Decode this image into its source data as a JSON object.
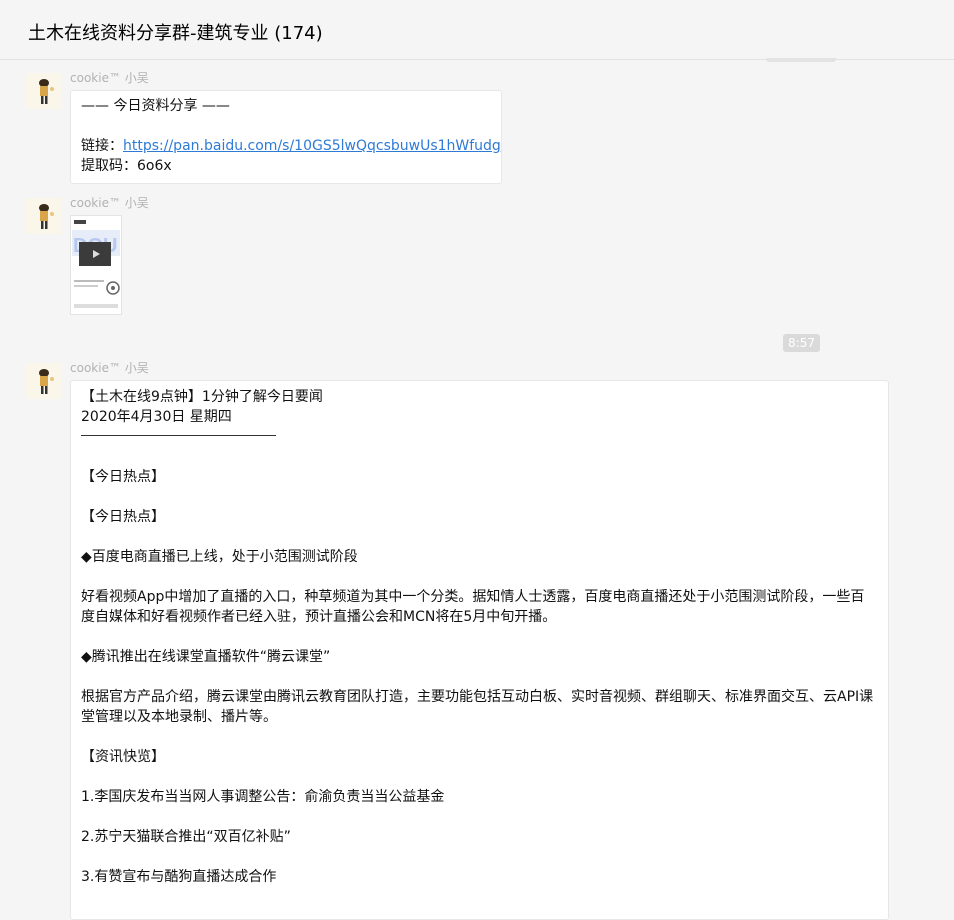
{
  "header": {
    "title": "土木在线资料分享群-建筑专业 (174)"
  },
  "messages": [
    {
      "sender": "cookie™ 小吴",
      "lines": {
        "heading": "——  今日资料分享  ——",
        "link_label": "链接：",
        "link_url": "https://pan.baidu.com/s/10GS5lwQqcsbuwUs1hWfudg",
        "code": "提取码：6o6x"
      }
    },
    {
      "sender": "cookie™ 小吴",
      "image": {
        "icon": "douyin-video-thumbnail-icon"
      }
    },
    {
      "sender": "cookie™ 小吴",
      "news": {
        "title": "【土木在线9点钟】1分钟了解今日要闻",
        "date": "2020年4月30日 星期四",
        "section1": "【今日热点】",
        "section2": "【今日热点】",
        "item1_title": "◆百度电商直播已上线，处于小范围测试阶段",
        "item1_body": "好看视频App中增加了直播的入口，种草频道为其中一个分类。据知情人士透露，百度电商直播还处于小范围测试阶段，一些百度自媒体和好看视频作者已经入驻，预计直播公会和MCN将在5月中旬开播。",
        "item2_title": "◆腾讯推出在线课堂直播软件“腾云课堂”",
        "item2_body": "根据官方产品介绍，腾云课堂由腾讯云教育团队打造，主要功能包括互动白板、实时音视频、群组聊天、标准界面交互、云API课堂管理以及本地录制、播片等。",
        "section3": "【资讯快览】",
        "quick1": "1.李国庆发布当当网人事调整公告：俞渝负责当当公益基金",
        "quick2": "2.苏宁天猫联合推出“双百亿补贴”",
        "quick3": "3.有赞宣布与酷狗直播达成合作"
      }
    }
  ],
  "timestamp": "8:57",
  "colors": {
    "link": "#2e7bd6",
    "background": "#f5f5f5",
    "bubble": "#ffffff",
    "badge": "#dadada"
  }
}
